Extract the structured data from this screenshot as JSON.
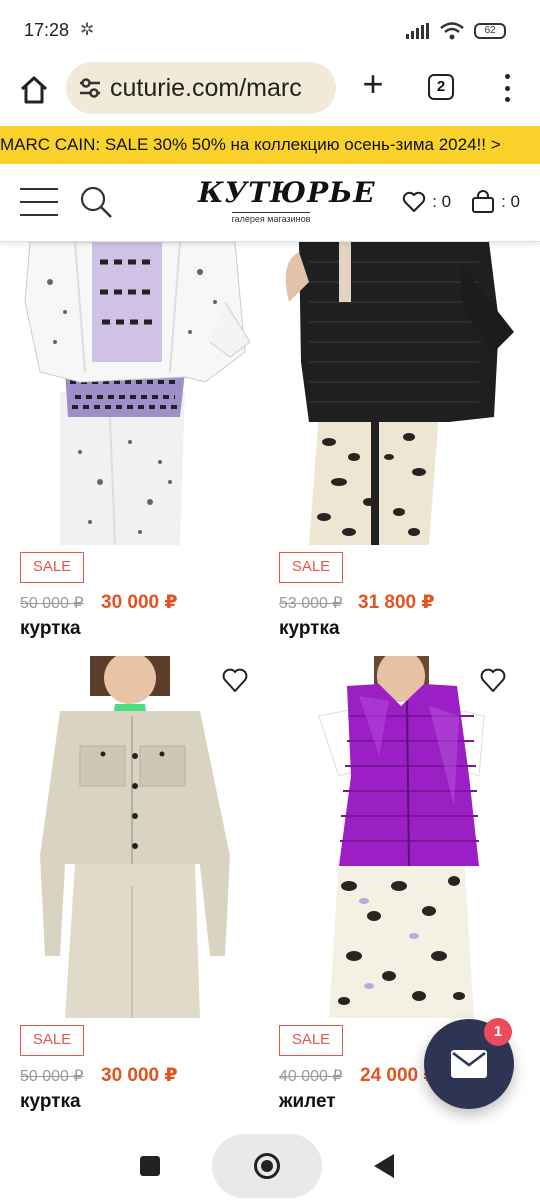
{
  "status": {
    "time": "17:28",
    "battery": "62"
  },
  "browser": {
    "url": "cuturie.com/marc",
    "tab_count": "2"
  },
  "promo": {
    "text": "MARC CAIN: SALE 30% 50% на коллекцию осень-зима 2024!! >"
  },
  "header": {
    "logo_name": "КУТЮРЬЕ",
    "logo_tagline": "галерея магазинов",
    "wishlist_count": ": 0",
    "cart_count": ": 0"
  },
  "products": [
    {
      "badge": "SALE",
      "old_price": "50 000 ₽",
      "new_price": "30 000 ₽",
      "title": "куртка"
    },
    {
      "badge": "SALE",
      "old_price": "53 000 ₽",
      "new_price": "31 800 ₽",
      "title": "куртка"
    },
    {
      "badge": "SALE",
      "old_price": "50 000 ₽",
      "new_price": "30 000 ₽",
      "title": "куртка"
    },
    {
      "badge": "SALE",
      "old_price": "40 000 ₽",
      "new_price": "24 000 ₽",
      "title": "жилет"
    }
  ],
  "chat": {
    "badge_count": "1"
  },
  "colors": {
    "accent_price": "#e4531f",
    "sale_badge": "#e0584f",
    "promo_bg": "#fbd22b",
    "chat_bg": "#2e3453"
  },
  "icons": [
    "gear-icon",
    "signal-icon",
    "wifi-icon",
    "home-icon",
    "site-settings-icon",
    "plus-icon",
    "tabs-icon",
    "more-vert-icon",
    "hamburger-icon",
    "search-icon",
    "heart-icon",
    "bag-icon",
    "mail-icon"
  ]
}
